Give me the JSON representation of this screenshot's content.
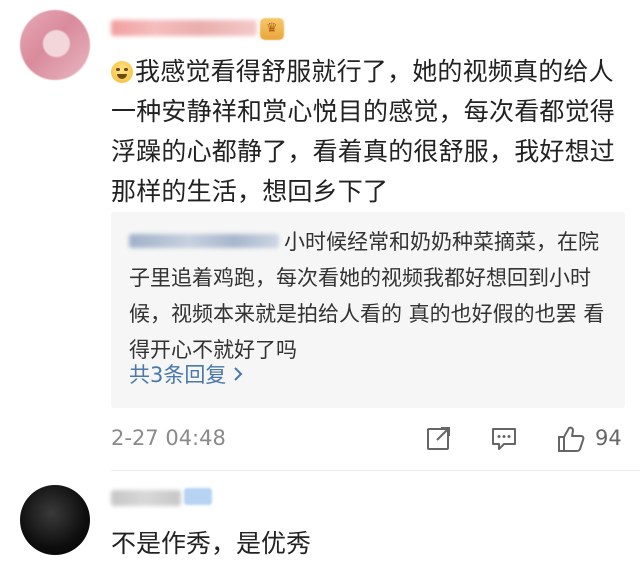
{
  "comments": [
    {
      "text": "我感觉看得舒服就行了，她的视频真的给人一种安静祥和赏心悦目的感觉，每次看都觉得浮躁的心都静了，看着真的很舒服，我好想过那样的生活，想回乡下了",
      "reply_text": "小时候经常和奶奶种菜摘菜，在院子里追着鸡跑，每次看她的视频我都好想回到小时候，视频本来就是拍给人看的 真的也好假的也罢 看得开心不就好了吗",
      "reply_more": "共3条回复",
      "time": "2-27 04:48",
      "likes": "94"
    },
    {
      "text": "不是作秀，是优秀"
    }
  ],
  "colors": {
    "text": "#222222",
    "meta": "#8a8a8a",
    "link": "#4a78a8",
    "reply_bg": "#f6f6f6"
  },
  "icons": [
    "emoji-laughing-icon",
    "share-icon",
    "comment-icon",
    "like-icon",
    "chevron-right-icon"
  ]
}
